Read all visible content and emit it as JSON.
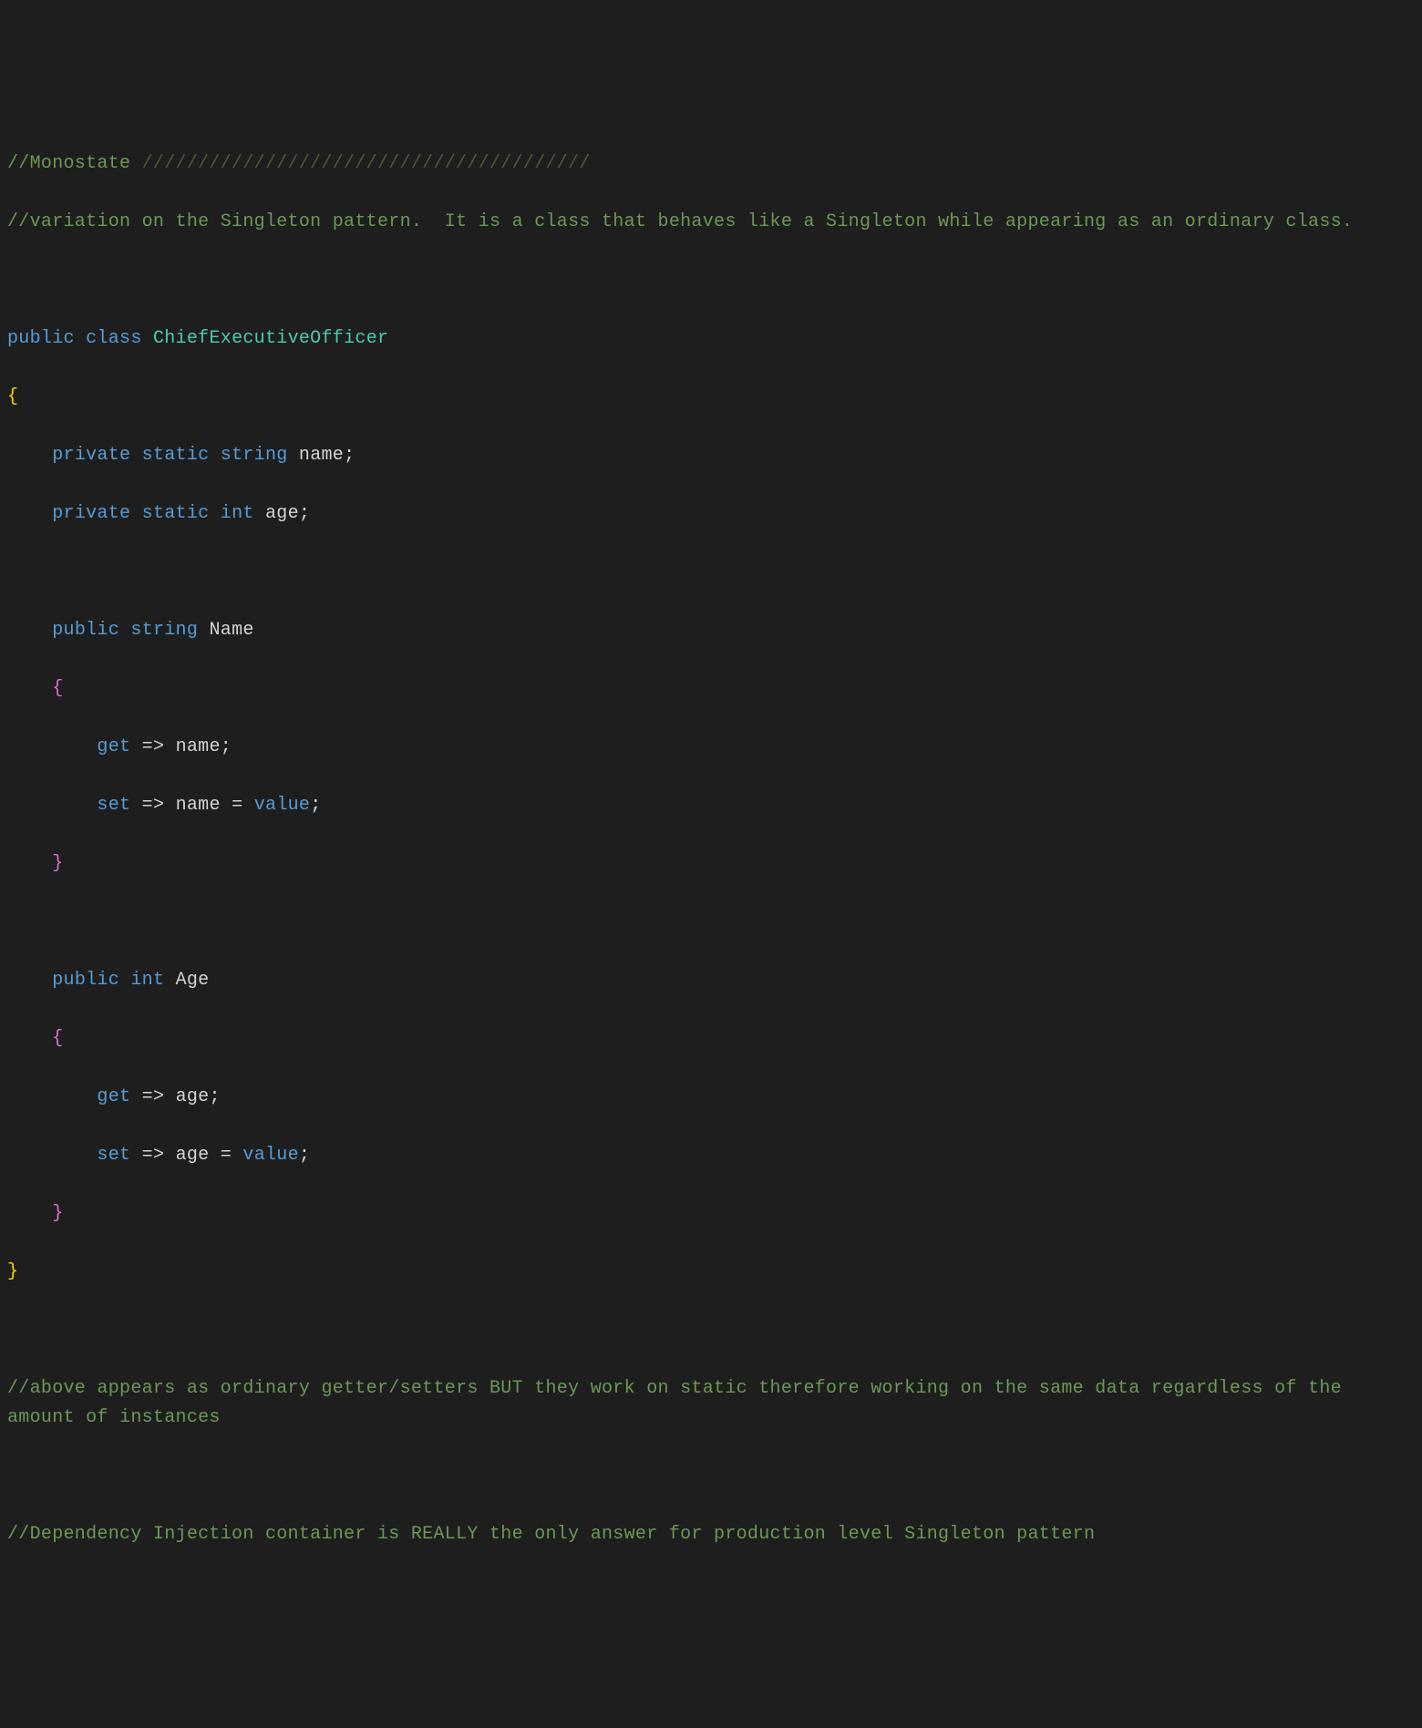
{
  "lines": {
    "l1_comment_prefix": "//Monostate ",
    "l1_slashes": "////////////////////////////////////////",
    "l2": "//variation on the Singleton pattern.  It is a class that behaves like a Singleton while appearing as an ordinary class.",
    "l3": "",
    "l4_public": "public",
    "l4_class": "class",
    "l4_name": "ChiefExecutiveOfficer",
    "l5_brace": "{",
    "l6_indent": "    ",
    "l6_private": "private",
    "l6_static": "static",
    "l6_string": "string",
    "l6_name": "name",
    "l6_semi": ";",
    "l7_indent": "    ",
    "l7_private": "private",
    "l7_static": "static",
    "l7_int": "int",
    "l7_age": "age",
    "l7_semi": ";",
    "l8": "",
    "l9_indent": "    ",
    "l9_public": "public",
    "l9_string": "string",
    "l9_name": "Name",
    "l10_indent": "    ",
    "l10_brace": "{",
    "l11_indent": "        ",
    "l11_get": "get",
    "l11_arrow": "=>",
    "l11_name": "name",
    "l11_semi": ";",
    "l12_indent": "        ",
    "l12_set": "set",
    "l12_arrow": "=>",
    "l12_name": "name",
    "l12_eq": "=",
    "l12_value": "value",
    "l12_semi": ";",
    "l13_indent": "    ",
    "l13_brace": "}",
    "l14": "",
    "l15_indent": "    ",
    "l15_public": "public",
    "l15_int": "int",
    "l15_age": "Age",
    "l16_indent": "    ",
    "l16_brace": "{",
    "l17_indent": "        ",
    "l17_get": "get",
    "l17_arrow": "=>",
    "l17_age": "age",
    "l17_semi": ";",
    "l18_indent": "        ",
    "l18_set": "set",
    "l18_arrow": "=>",
    "l18_age": "age",
    "l18_eq": "=",
    "l18_value": "value",
    "l18_semi": ";",
    "l19_indent": "    ",
    "l19_brace": "}",
    "l20_brace": "}",
    "l21": "",
    "l22": "//above appears as ordinary getter/setters BUT they work on static therefore working on the same data regardless of the amount of instances",
    "l23": "",
    "l24": "//Dependency Injection container is REALLY the only answer for production level Singleton pattern"
  }
}
